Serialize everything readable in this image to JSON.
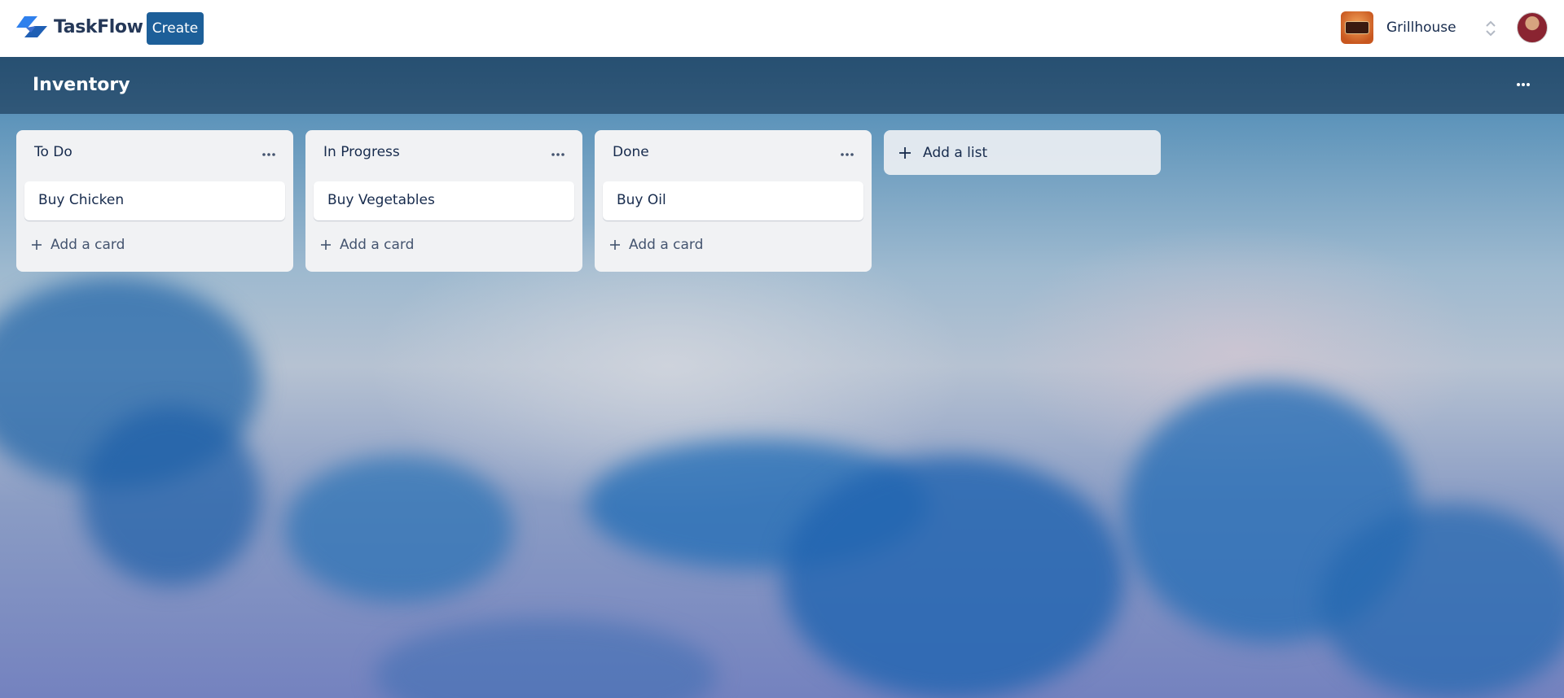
{
  "app": {
    "name": "TaskFlow",
    "brand_color": "#1d5f99"
  },
  "topnav": {
    "create_label": "Create",
    "workspace_name": "Grillhouse",
    "icons": [
      "taskflow-logo-icon",
      "workspace-logo-icon",
      "chevron-updown-icon",
      "user-avatar"
    ]
  },
  "board": {
    "title": "Inventory",
    "menu_icon": "more-horizontal-icon",
    "lists": [
      {
        "title": "To Do",
        "cards": [
          {
            "title": "Buy Chicken"
          }
        ],
        "add_card_label": "Add a card"
      },
      {
        "title": "In Progress",
        "cards": [
          {
            "title": "Buy Vegetables"
          }
        ],
        "add_card_label": "Add a card"
      },
      {
        "title": "Done",
        "cards": [
          {
            "title": "Buy Oil"
          }
        ],
        "add_card_label": "Add a card"
      }
    ],
    "add_list_label": "Add a list"
  }
}
